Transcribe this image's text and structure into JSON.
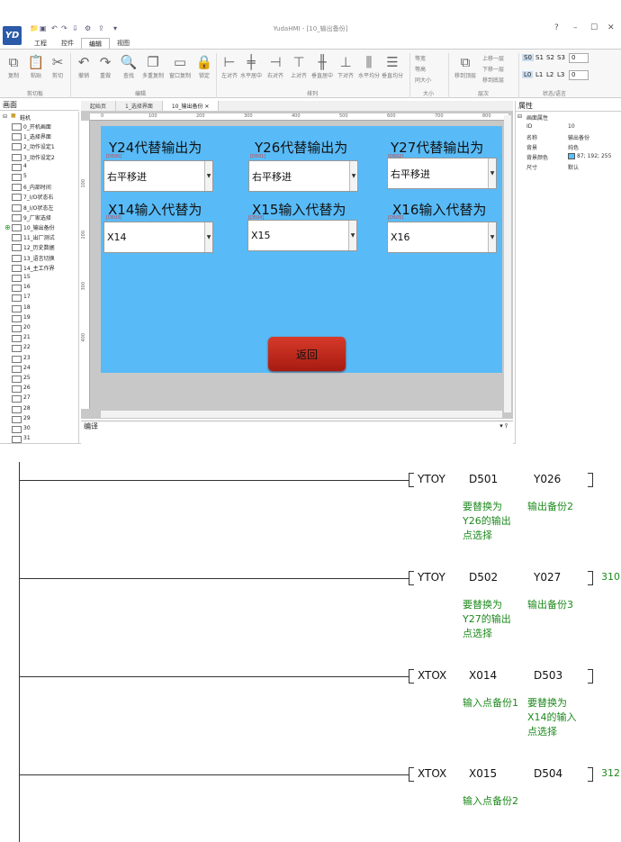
{
  "app": {
    "logo": "YD",
    "title": "YudaHMI - [10_输出备份]",
    "menus": [
      "工程",
      "控件",
      "编辑",
      "视图"
    ],
    "active_menu": "编辑",
    "ribbon": {
      "buttons": [
        "复制",
        "粘贴",
        "剪切",
        "撤销",
        "重做",
        "查找",
        "多重复制",
        "窗口复制",
        "锁定",
        "左对齐",
        "水平居中",
        "右对齐",
        "上对齐",
        "垂直居中",
        "下对齐",
        "水平均分",
        "垂直均分",
        "等宽",
        "等高",
        "同大小",
        "移到顶层",
        "上移一层",
        "下移一层",
        "移到底层"
      ],
      "groups": [
        "剪切板",
        "编辑",
        "排列",
        "大小",
        "层次",
        "状态/语言"
      ],
      "state_buttons": [
        "S0",
        "S1",
        "S2",
        "S3",
        "L0",
        "L1",
        "L2",
        "L3"
      ],
      "state_value": "0",
      "lang_value": "0"
    },
    "left_panel": {
      "title": "画面",
      "root": "鞋机",
      "items": [
        "0_开机画面",
        "1_选择界面",
        "2_动作设定1",
        "3_动作设定2",
        "4",
        "5",
        "6_内部时间",
        "7_I/O状态右",
        "8_I/O状态左",
        "9_厂家选择",
        "10_输出备份",
        "11_出厂测试",
        "12_历史数据",
        "13_语言切换",
        "14_主工作界",
        "15",
        "16",
        "17",
        "18",
        "19",
        "20",
        "21",
        "22",
        "23",
        "24",
        "25",
        "26",
        "27",
        "28",
        "29",
        "30",
        "31"
      ]
    },
    "tabs": [
      "起始页",
      "1_选择界面",
      "10_输出备份"
    ],
    "ruler_ticks": [
      "0",
      "100",
      "200",
      "300",
      "400",
      "500",
      "600",
      "700",
      "800"
    ],
    "ruler_v_ticks": [
      "100",
      "200",
      "300",
      "400"
    ],
    "screen": {
      "labels": [
        "Y24代替输出为",
        "Y26代替输出为",
        "Y27代替输出为",
        "X14输入代替为",
        "X15输入代替为",
        "X16输入代替为"
      ],
      "addrs": [
        "[D500]",
        "[D501]",
        "[D502]",
        "[D503]",
        "[D504]",
        "[D505]"
      ],
      "combos": [
        "右平移进",
        "右平移进",
        "右平移进",
        "X14",
        "X15",
        "X16"
      ],
      "back_button": "返回"
    },
    "compile_panel": "编译",
    "properties": {
      "title": "属性",
      "section": "画面属性",
      "rows": [
        {
          "k": "ID",
          "v": "10"
        },
        {
          "k": "名称",
          "v": "输出备份"
        },
        {
          "k": "背景",
          "v": "纯色"
        },
        {
          "k": "背景颜色",
          "v": "87; 192; 255"
        },
        {
          "k": "尺寸",
          "v": "默认"
        }
      ],
      "bg_color": "#57c0ff"
    }
  },
  "ladder": {
    "rungs": [
      {
        "op": "YTOY",
        "a": "D501",
        "b": "Y026",
        "ca": "要替换为Y26的输出点选择",
        "cb": "输出备份2",
        "step": ""
      },
      {
        "op": "YTOY",
        "a": "D502",
        "b": "Y027",
        "ca": "要替换为Y27的输出点选择",
        "cb": "输出备份3",
        "step": "310"
      },
      {
        "op": "XTOX",
        "a": "X014",
        "b": "D503",
        "ca": "输入点备份1",
        "cb": "要替换为X14的输入点选择",
        "step": ""
      },
      {
        "op": "XTOX",
        "a": "X015",
        "b": "D504",
        "ca": "输入点备份2",
        "cb": "",
        "step": "312"
      }
    ]
  }
}
